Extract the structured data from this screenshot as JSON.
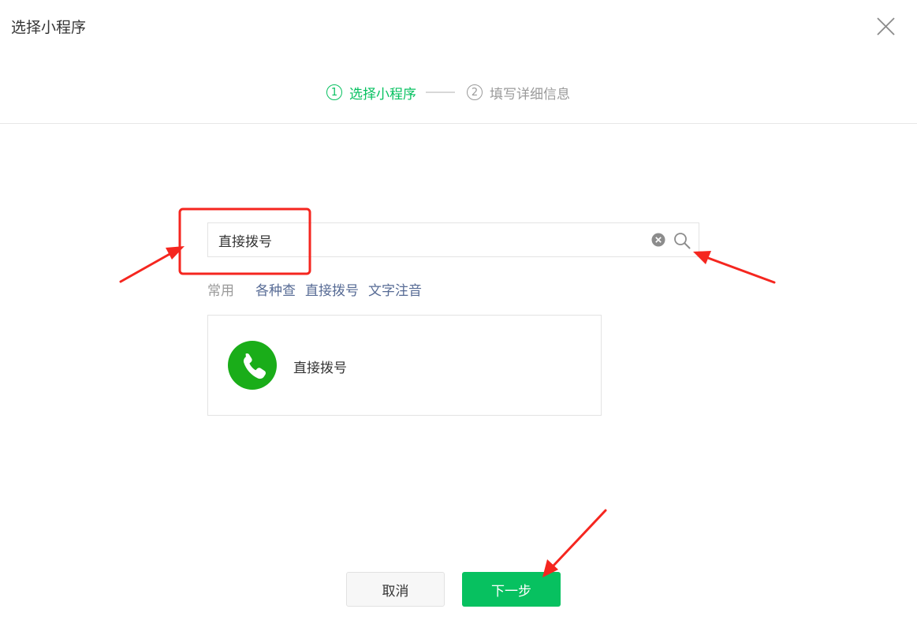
{
  "dialog": {
    "title": "选择小程序"
  },
  "steps": [
    {
      "number": "1",
      "label": "选择小程序",
      "state": "active"
    },
    {
      "number": "2",
      "label": "填写详细信息",
      "state": "inactive"
    }
  ],
  "search": {
    "value": "直接拨号",
    "placeholder": ""
  },
  "quick_tags": {
    "label": "常用",
    "items": [
      "各种查",
      "直接拨号",
      "文字注音"
    ]
  },
  "result": {
    "name": "直接拨号",
    "icon": "phone-icon"
  },
  "footer": {
    "cancel_label": "取消",
    "next_label": "下一步"
  },
  "colors": {
    "accent": "#07c160",
    "link": "#576b95",
    "annotation": "#f5261f"
  }
}
